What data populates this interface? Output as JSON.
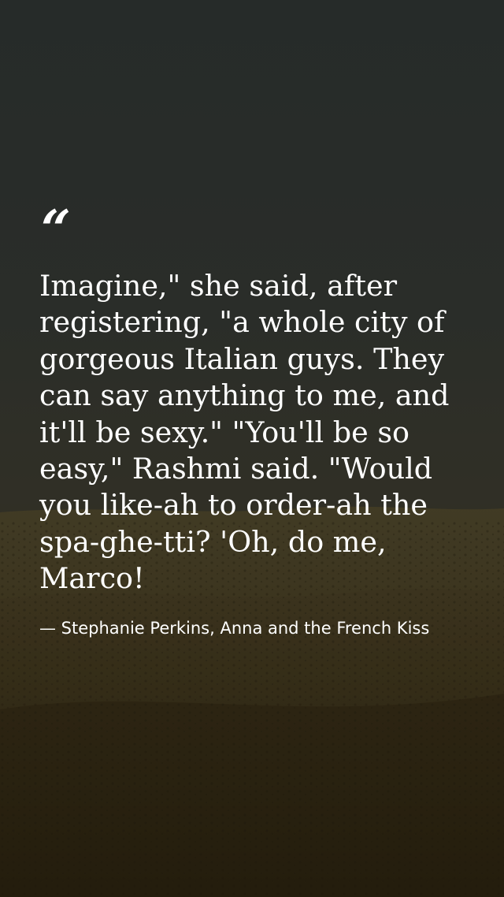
{
  "quote": {
    "mark": "“",
    "text": "Imagine,\" she said, after registering, \"a whole city of gorgeous Italian guys. They can say anything to me, and it'll be sexy.\" \"You'll be so easy,\" Rashmi said. \"Would you like-ah to order-ah the spa-ghe-tti? 'Oh, do me, Marco!",
    "attribution": "— Stephanie Perkins, Anna and the French Kiss"
  },
  "colors": {
    "text": "#ffffff",
    "background_top": "#2b2f2c",
    "background_bottom": "#2a2110"
  }
}
